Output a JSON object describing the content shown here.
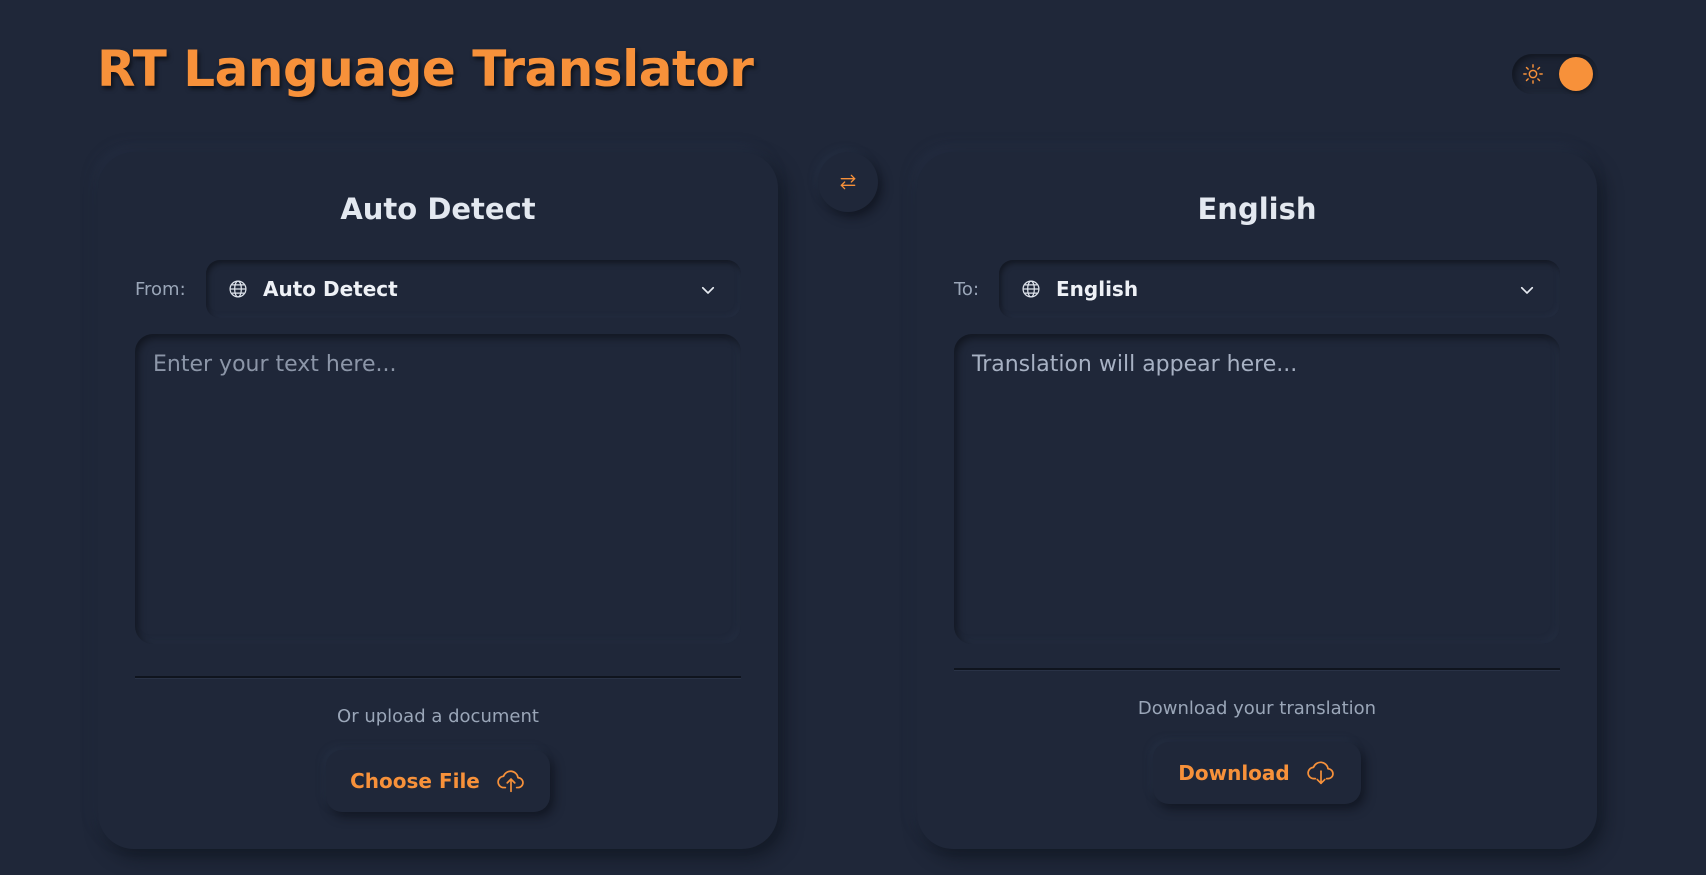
{
  "app": {
    "title": "RT Language Translator"
  },
  "theme_toggle": {
    "icon": "sun-icon",
    "state": "on",
    "accent": "#f7913a"
  },
  "swap": {
    "icon": "swap-arrows-icon"
  },
  "source": {
    "heading": "Auto Detect",
    "label": "From:",
    "selected_language": "Auto Detect",
    "input_placeholder": "Enter your text here...",
    "upload_prompt": "Or upload a document",
    "upload_button": "Choose File",
    "upload_icon": "cloud-upload-icon"
  },
  "target": {
    "heading": "English",
    "label": "To:",
    "selected_language": "English",
    "output_placeholder": "Translation will appear here...",
    "download_prompt": "Download your translation",
    "download_button": "Download",
    "download_icon": "cloud-download-icon"
  },
  "colors": {
    "background": "#1f2739",
    "accent": "#f7913a",
    "heading_text": "#e3e8f0",
    "muted_text": "#9aa6b8"
  }
}
